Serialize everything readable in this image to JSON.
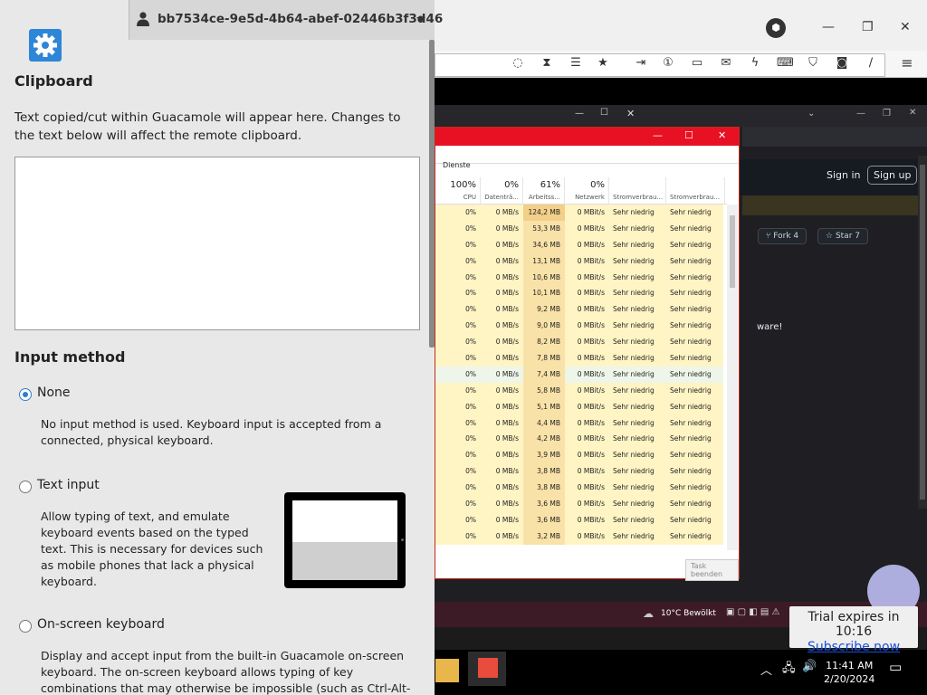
{
  "sidebar": {
    "user": "bb7534ce-9e5d-4b64-abef-02446b3f3d46",
    "clipboard_title": "Clipboard",
    "clipboard_desc": "Text copied/cut within Guacamole will appear here. Changes to the text below will affect the remote clipboard.",
    "clipboard_value": "",
    "input_title": "Input method",
    "options": [
      {
        "label": "None",
        "selected": true,
        "desc": "No input method is used. Keyboard input is accepted from a connected, physical keyboard."
      },
      {
        "label": "Text input",
        "selected": false,
        "desc": "Allow typing of text, and emulate keyboard events based on the typed text. This is necessary for devices such as mobile phones that lack a physical keyboard."
      },
      {
        "label": "On-screen keyboard",
        "selected": false,
        "desc": "Display and accept input from the built-in Guacamole on-screen keyboard. The on-screen keyboard allows typing of key combinations that may otherwise be impossible (such as Ctrl-Alt-"
      }
    ]
  },
  "remote": {
    "github": {
      "signin": "Sign in",
      "signup": "Sign up",
      "fork": "Fork",
      "fork_count": "4",
      "star": "Star",
      "star_count": "7",
      "snippet": "ware!"
    },
    "taskmgr": {
      "tab": "Dienste",
      "columns": [
        {
          "pct": "100%",
          "name": "CPU"
        },
        {
          "pct": "0%",
          "name": "Datenträ..."
        },
        {
          "pct": "61%",
          "name": "Arbeitss..."
        },
        {
          "pct": "0%",
          "name": "Netzwerk"
        },
        {
          "pct": "",
          "name": "Stromverbrau..."
        },
        {
          "pct": "",
          "name": "Stromverbrau..."
        }
      ],
      "rows": [
        [
          "0%",
          "0 MB/s",
          "124,2 MB",
          "0 MBit/s",
          "Sehr niedrig",
          "Sehr niedrig"
        ],
        [
          "0%",
          "0 MB/s",
          "53,3 MB",
          "0 MBit/s",
          "Sehr niedrig",
          "Sehr niedrig"
        ],
        [
          "0%",
          "0 MB/s",
          "34,6 MB",
          "0 MBit/s",
          "Sehr niedrig",
          "Sehr niedrig"
        ],
        [
          "0%",
          "0 MB/s",
          "13,1 MB",
          "0 MBit/s",
          "Sehr niedrig",
          "Sehr niedrig"
        ],
        [
          "0%",
          "0 MB/s",
          "10,6 MB",
          "0 MBit/s",
          "Sehr niedrig",
          "Sehr niedrig"
        ],
        [
          "0%",
          "0 MB/s",
          "10,1 MB",
          "0 MBit/s",
          "Sehr niedrig",
          "Sehr niedrig"
        ],
        [
          "0%",
          "0 MB/s",
          "9,2 MB",
          "0 MBit/s",
          "Sehr niedrig",
          "Sehr niedrig"
        ],
        [
          "0%",
          "0 MB/s",
          "9,0 MB",
          "0 MBit/s",
          "Sehr niedrig",
          "Sehr niedrig"
        ],
        [
          "0%",
          "0 MB/s",
          "8,2 MB",
          "0 MBit/s",
          "Sehr niedrig",
          "Sehr niedrig"
        ],
        [
          "0%",
          "0 MB/s",
          "7,8 MB",
          "0 MBit/s",
          "Sehr niedrig",
          "Sehr niedrig"
        ],
        [
          "0%",
          "0 MB/s",
          "7,4 MB",
          "0 MBit/s",
          "Sehr niedrig",
          "Sehr niedrig"
        ],
        [
          "0%",
          "0 MB/s",
          "5,8 MB",
          "0 MBit/s",
          "Sehr niedrig",
          "Sehr niedrig"
        ],
        [
          "0%",
          "0 MB/s",
          "5,1 MB",
          "0 MBit/s",
          "Sehr niedrig",
          "Sehr niedrig"
        ],
        [
          "0%",
          "0 MB/s",
          "4,4 MB",
          "0 MBit/s",
          "Sehr niedrig",
          "Sehr niedrig"
        ],
        [
          "0%",
          "0 MB/s",
          "4,2 MB",
          "0 MBit/s",
          "Sehr niedrig",
          "Sehr niedrig"
        ],
        [
          "0%",
          "0 MB/s",
          "3,9 MB",
          "0 MBit/s",
          "Sehr niedrig",
          "Sehr niedrig"
        ],
        [
          "0%",
          "0 MB/s",
          "3,8 MB",
          "0 MBit/s",
          "Sehr niedrig",
          "Sehr niedrig"
        ],
        [
          "0%",
          "0 MB/s",
          "3,8 MB",
          "0 MBit/s",
          "Sehr niedrig",
          "Sehr niedrig"
        ],
        [
          "0%",
          "0 MB/s",
          "3,6 MB",
          "0 MBit/s",
          "Sehr niedrig",
          "Sehr niedrig"
        ],
        [
          "0%",
          "0 MB/s",
          "3,6 MB",
          "0 MBit/s",
          "Sehr niedrig",
          "Sehr niedrig"
        ],
        [
          "0%",
          "0 MB/s",
          "3,2 MB",
          "0 MBit/s",
          "Sehr niedrig",
          "Sehr niedrig"
        ]
      ],
      "end_task": "Task beenden"
    },
    "weather": "10°C  Bewölkt",
    "clock_time": "11:41 AM",
    "clock_date": "2/20/2024",
    "trial": "Trial expires in 10:16",
    "subscribe": "Subscribe now"
  },
  "colors": {
    "accent": "#2e7dd1",
    "taskmgr_red": "#e81123",
    "highlight": "#fff4c4",
    "mem_highlight": "#f9e2a8"
  }
}
